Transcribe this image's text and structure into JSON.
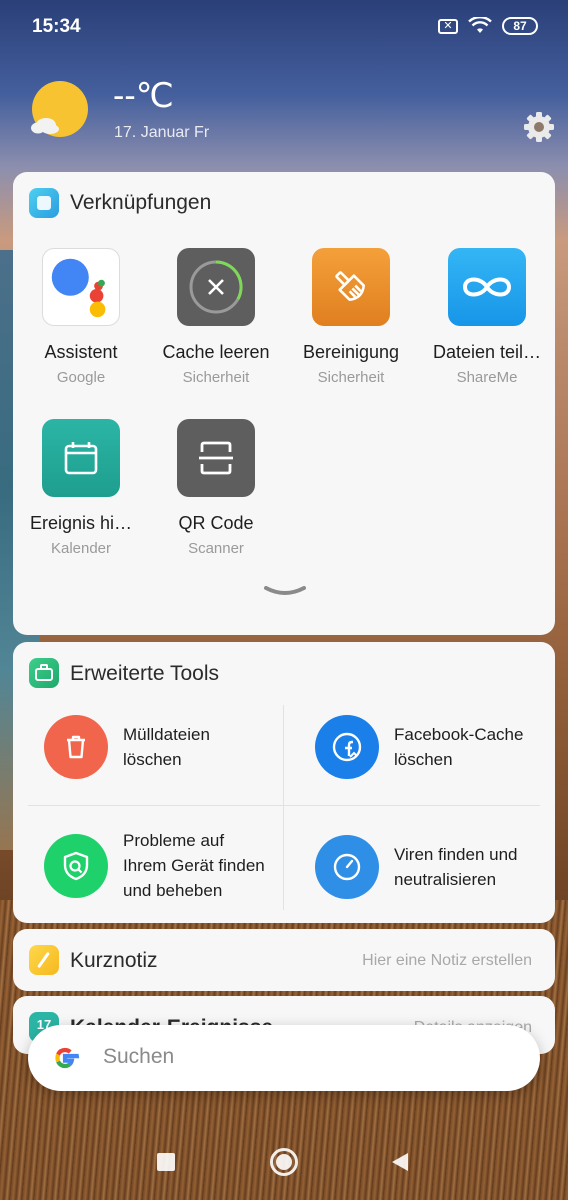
{
  "status_bar": {
    "time": "15:34",
    "battery": "87"
  },
  "weather": {
    "temperature": "--℃",
    "date": "17. Januar Fr"
  },
  "shortcuts_card": {
    "title": "Verknüpfungen",
    "items": [
      {
        "label": "Assistent",
        "sub": "Google",
        "icon": "google-assistant-icon"
      },
      {
        "label": "Cache leeren",
        "sub": "Sicherheit",
        "icon": "cache-clear-icon"
      },
      {
        "label": "Bereinigung",
        "sub": "Sicherheit",
        "icon": "broom-icon"
      },
      {
        "label": "Dateien teil…",
        "sub": "ShareMe",
        "icon": "infinity-icon"
      },
      {
        "label": "Ereignis hi…",
        "sub": "Kalender",
        "icon": "calendar-icon"
      },
      {
        "label": "QR Code",
        "sub": "Scanner",
        "icon": "qr-scanner-icon"
      }
    ],
    "colors": {
      "cache": "#5e5e5e",
      "clean": "#ee8d2a",
      "share": "#1fa6f0",
      "calendar": "#22aa9a",
      "qr": "#5e5e5e"
    }
  },
  "tools_card": {
    "title": "Erweiterte Tools",
    "items": [
      {
        "line1": "Mülldateien",
        "line2": "löschen",
        "line3": "",
        "icon": "trash-icon",
        "color": "#f0654b"
      },
      {
        "line1": "Facebook-Cache",
        "line2": "löschen",
        "line3": "",
        "icon": "facebook-clean-icon",
        "color": "#1a7fe8"
      },
      {
        "line1": "Probleme auf",
        "line2": "Ihrem Gerät finden",
        "line3": "und beheben",
        "icon": "shield-search-icon",
        "color": "#1fd16b"
      },
      {
        "line1": "Viren finden und",
        "line2": "neutralisieren",
        "line3": "",
        "icon": "antivirus-icon",
        "color": "#2f8ee6"
      }
    ]
  },
  "note_card": {
    "title": "Kurznotiz",
    "placeholder": "Hier eine Notiz erstellen"
  },
  "calendar_card": {
    "title": "Kalender-Ereignisse",
    "action": "Details anzeigen"
  },
  "search": {
    "placeholder": "Suchen"
  }
}
